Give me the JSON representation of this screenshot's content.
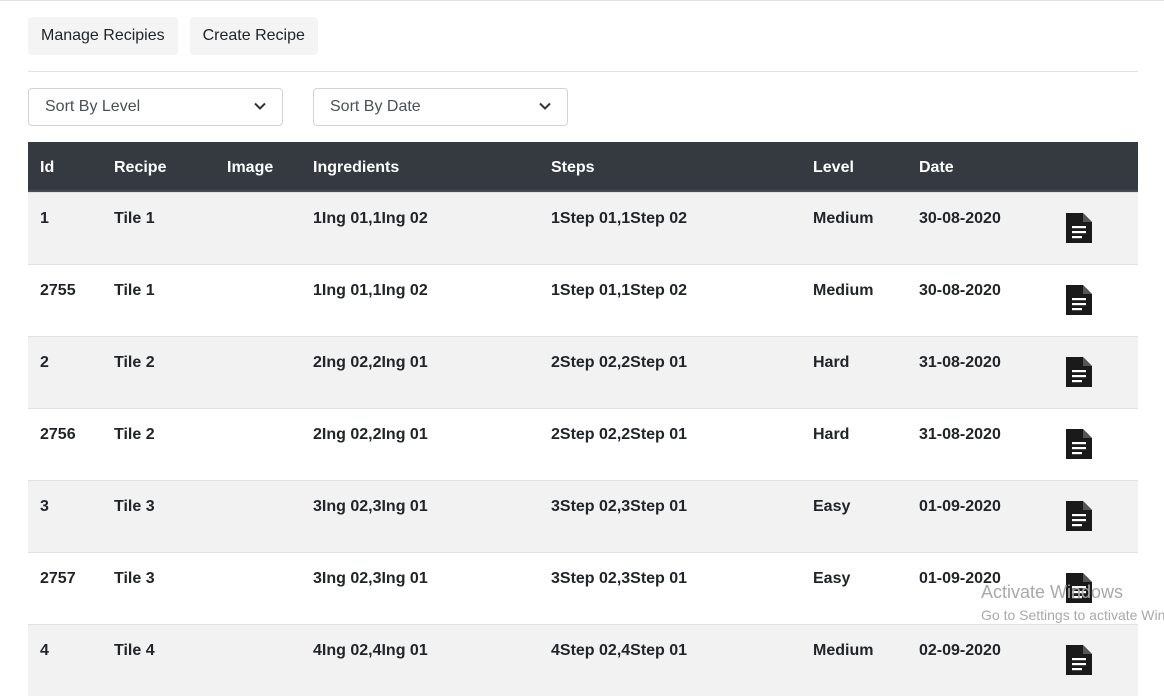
{
  "nav": {
    "manage_label": "Manage Recipies",
    "create_label": "Create Recipe"
  },
  "filters": {
    "level_selected": "Sort By Level",
    "date_selected": "Sort By Date"
  },
  "table": {
    "headers": {
      "id": "Id",
      "recipe": "Recipe",
      "image": "Image",
      "ingredients": "Ingredients",
      "steps": "Steps",
      "level": "Level",
      "date": "Date"
    },
    "rows": [
      {
        "id": "1",
        "recipe": "Tile 1",
        "ingredients": "1Ing 01,1Ing 02",
        "steps": "1Step 01,1Step 02",
        "level": "Medium",
        "date": "30-08-2020"
      },
      {
        "id": "2755",
        "recipe": "Tile 1",
        "ingredients": "1Ing 01,1Ing 02",
        "steps": "1Step 01,1Step 02",
        "level": "Medium",
        "date": "30-08-2020"
      },
      {
        "id": "2",
        "recipe": "Tile 2",
        "ingredients": "2Ing 02,2Ing 01",
        "steps": "2Step 02,2Step 01",
        "level": "Hard",
        "date": "31-08-2020"
      },
      {
        "id": "2756",
        "recipe": "Tile 2",
        "ingredients": "2Ing 02,2Ing 01",
        "steps": "2Step 02,2Step 01",
        "level": "Hard",
        "date": "31-08-2020"
      },
      {
        "id": "3",
        "recipe": "Tile 3",
        "ingredients": "3Ing 02,3Ing 01",
        "steps": "3Step 02,3Step 01",
        "level": "Easy",
        "date": "01-09-2020"
      },
      {
        "id": "2757",
        "recipe": "Tile 3",
        "ingredients": "3Ing 02,3Ing 01",
        "steps": "3Step 02,3Step 01",
        "level": "Easy",
        "date": "01-09-2020"
      },
      {
        "id": "4",
        "recipe": "Tile 4",
        "ingredients": "4Ing 02,4Ing 01",
        "steps": "4Step 02,4Step 01",
        "level": "Medium",
        "date": "02-09-2020"
      }
    ],
    "row_action_icon": "document-icon"
  },
  "watermark": {
    "line1": "Activate Windows",
    "line2": "Go to Settings to activate Windows."
  },
  "colors": {
    "header_bg": "#343a40",
    "stripe_bg": "#f2f2f2",
    "nav_btn_bg": "#f4f4f4"
  }
}
